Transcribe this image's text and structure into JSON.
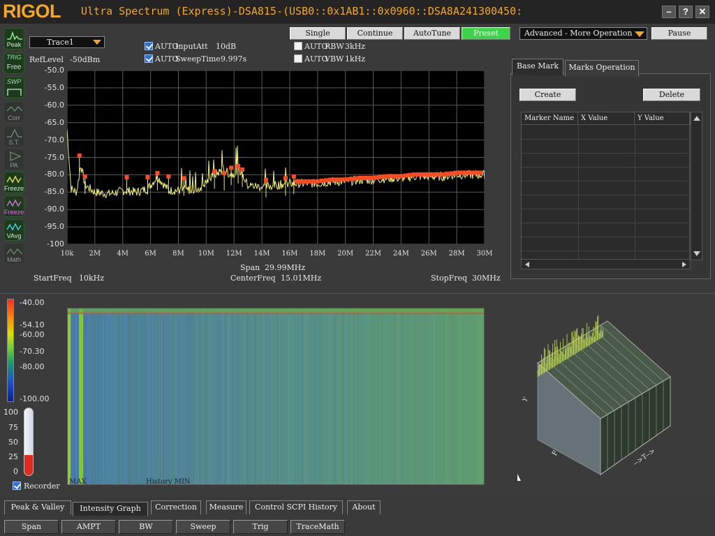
{
  "title_bar": {
    "logo": "RIGOL",
    "title": "Ultra Spectrum (Express)-DSA815-(USB0::0x1AB1::0x0960::DSA8A241300450:"
  },
  "window_controls": {
    "minimize": "–",
    "help": "?",
    "close": "✕"
  },
  "left_rail": [
    {
      "label": "Peak",
      "top": "",
      "icon": "peak-icon"
    },
    {
      "label": "Free",
      "top": "TRIG",
      "icon": "trigger-icon"
    },
    {
      "label": "",
      "top": "SWP",
      "icon": "sweep-icon"
    },
    {
      "label": "Corr",
      "top": "",
      "icon": "correction-icon"
    },
    {
      "label": "S.T.",
      "top": "",
      "icon": "signal-track-icon"
    },
    {
      "label": "PA",
      "top": "",
      "icon": "preamp-icon"
    },
    {
      "label": "Freeze",
      "top": "",
      "icon": "freeze-icon"
    },
    {
      "label": "Freeze",
      "top": "",
      "icon": "freeze-all-icon"
    },
    {
      "label": "VAvg",
      "top": "",
      "icon": "video-average-icon"
    },
    {
      "label": "Math",
      "top": "",
      "icon": "math-icon"
    }
  ],
  "trace_select": "Trace1",
  "ref_level": {
    "label": "RefLevel",
    "value": "-50dBm"
  },
  "settings": {
    "input_att": {
      "checked": true,
      "auto": "AUTO",
      "label": "InputAtt",
      "value": "10dB"
    },
    "sweep_time": {
      "checked": true,
      "auto": "AUTO",
      "label": "SweepTime",
      "value": "9.997s"
    },
    "rbw": {
      "checked": false,
      "auto": "AUTO",
      "label": "RBW",
      "value": "3kHz"
    },
    "vbw": {
      "checked": false,
      "auto": "AUTO",
      "label": "VBW",
      "value": "1kHz"
    }
  },
  "toolbar": {
    "single": "Single",
    "continue": "Continue",
    "autotune": "AutoTune",
    "preset": "Preset",
    "advanced": "Advanced - More Operation",
    "pause": "Pause"
  },
  "chart_data": {
    "type": "line",
    "y_ticks": [
      "-50.0",
      "-55.0",
      "-60.0",
      "-65.0",
      "-70.0",
      "-75.0",
      "-80.0",
      "-85.0",
      "-90.0",
      "-95.0",
      "-100"
    ],
    "x_ticks": [
      "10k",
      "2M",
      "4M",
      "6M",
      "8M",
      "10M",
      "12M",
      "14M",
      "16M",
      "18M",
      "20M",
      "22M",
      "24M",
      "26M",
      "28M",
      "30M"
    ],
    "ylim": [
      -100,
      -50
    ],
    "xlim": [
      0.01,
      30
    ],
    "grid": true,
    "series": [
      {
        "color": "#f2f27a",
        "x": [
          0.01,
          0.3,
          0.7,
          1.0,
          1.3,
          2,
          3,
          4.2,
          5,
          5.8,
          6.5,
          7.3,
          8.5,
          9.5,
          10.6,
          11.2,
          11.8,
          12.4,
          13,
          14,
          15,
          16,
          17,
          18,
          19,
          20,
          21,
          22,
          23,
          24,
          25,
          26,
          27,
          28,
          29,
          30
        ],
        "y": [
          -67,
          -84,
          -85,
          -77,
          -83,
          -85,
          -85.5,
          -84.5,
          -85,
          -84,
          -80.5,
          -84.5,
          -84.5,
          -84,
          -80,
          -78.5,
          -80,
          -78.5,
          -83,
          -83.5,
          -83,
          -82.5,
          -82.5,
          -82.5,
          -82,
          -82,
          -81.5,
          -81.5,
          -81,
          -81,
          -80.5,
          -80.5,
          -80.5,
          -80,
          -80,
          -80
        ]
      }
    ],
    "peaks": [
      {
        "x": 0.9,
        "y": -74.5
      },
      {
        "x": 1.3,
        "y": -80.5
      },
      {
        "x": 4.3,
        "y": -80.7
      },
      {
        "x": 5.8,
        "y": -80.7
      },
      {
        "x": 6.5,
        "y": -79.5
      },
      {
        "x": 7.3,
        "y": -80.5
      },
      {
        "x": 8.4,
        "y": -81
      },
      {
        "x": 10.6,
        "y": -79
      },
      {
        "x": 11.3,
        "y": -79.5
      },
      {
        "x": 11.8,
        "y": -78
      },
      {
        "x": 12.3,
        "y": -77.5
      },
      {
        "x": 12.6,
        "y": -78.5
      },
      {
        "x": 14.3,
        "y": -81.5
      },
      {
        "x": 15.7,
        "y": -81
      },
      {
        "x": 16.3,
        "y": -80.5
      }
    ]
  },
  "freq_info": {
    "start": {
      "label": "StartFreq",
      "value": "10kHz"
    },
    "center": {
      "label": "CenterFreq",
      "value": "15.01MHz"
    },
    "stop": {
      "label": "StopFreq",
      "value": "30MHz"
    },
    "span": {
      "label": "Span",
      "value": "29.99MHz"
    }
  },
  "marker_panel": {
    "tabs": [
      "Base Mark",
      "Marks Operation"
    ],
    "create": "Create",
    "delete": "Delete",
    "columns": [
      "Marker Name",
      "X Value",
      "Y Value"
    ]
  },
  "intensity": {
    "colorbar_labels": [
      "-40.00",
      "-54.10",
      "-60.00",
      "-70.30",
      "-80.00",
      "-100.00"
    ],
    "thermo_labels": [
      "100",
      "75",
      "50",
      "25",
      "0"
    ],
    "thermo_level": 0.3,
    "recorder_label": "Recorder",
    "recorder_checked": true,
    "max_label": "MAX",
    "min_label": "History MIN",
    "axis_3d": {
      "y": "Y",
      "f": "F",
      "t": "-->T-->"
    }
  },
  "bottom_tabs": [
    "Peak & Valley",
    "Intensity Graph",
    "Correction",
    "Measure",
    "Control SCPI History",
    "About"
  ],
  "soft_keys": [
    "Span",
    "AMPT",
    "BW",
    "Sweep",
    "Trig",
    "TraceMath"
  ]
}
